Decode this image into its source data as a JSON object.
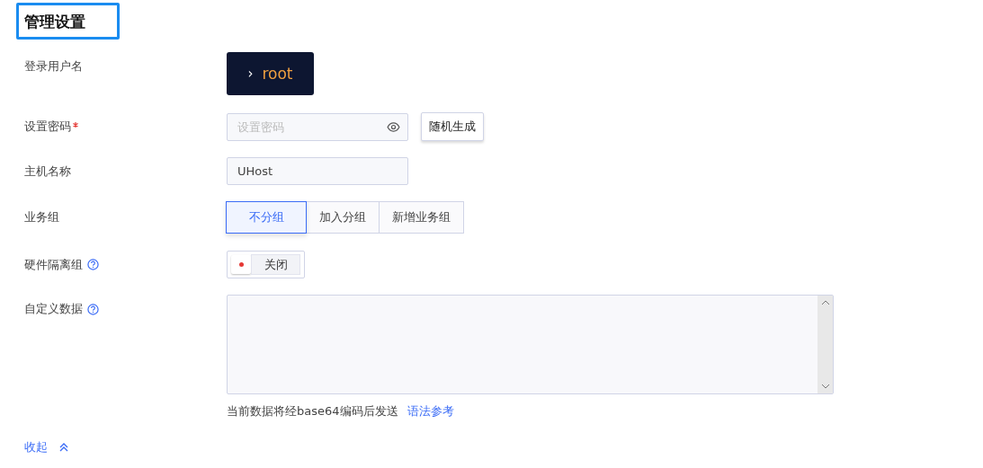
{
  "title": "管理设置",
  "username": {
    "label": "登录用户名",
    "prompt": "›",
    "value": "root"
  },
  "password": {
    "label": "设置密码",
    "required": true,
    "placeholder": "设置密码",
    "generate_button": "随机生成"
  },
  "hostname": {
    "label": "主机名称",
    "value": "UHost"
  },
  "business_group": {
    "label": "业务组",
    "options": [
      {
        "label": "不分组",
        "selected": true
      },
      {
        "label": "加入分组",
        "selected": false
      },
      {
        "label": "新增业务组",
        "selected": false
      }
    ]
  },
  "hardware_isolation": {
    "label": "硬件隔离组",
    "on": false,
    "state_text": "关闭"
  },
  "custom_data": {
    "label": "自定义数据",
    "hint": "当前数据将经base64编码后发送",
    "link": "语法参考"
  },
  "collapse": "收起"
}
